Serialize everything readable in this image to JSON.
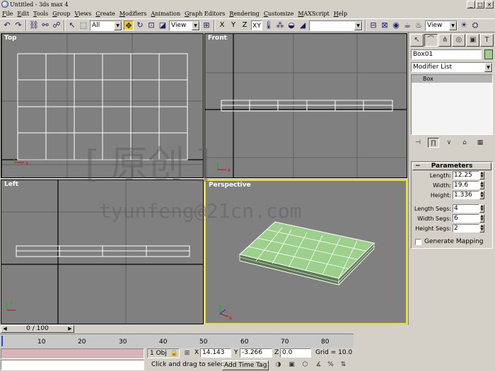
{
  "window": {
    "title": "Untitled - 3ds max 4"
  },
  "menu": [
    "File",
    "Edit",
    "Tools",
    "Group",
    "Views",
    "Create",
    "Modifiers",
    "Animation",
    "Graph Editors",
    "Rendering",
    "Customize",
    "MAXScript",
    "Help"
  ],
  "toolbar": {
    "selection_filter": "All",
    "ref_coord": "View",
    "axis_x": "X",
    "axis_y": "Y",
    "axis_z": "Z",
    "axis_xy": "XY",
    "named_selection": "",
    "render_type": "View"
  },
  "viewports": {
    "top": "Top",
    "front": "Front",
    "left": "Left",
    "perspective": "Perspective"
  },
  "watermark": {
    "line1": "[ 原创 ]",
    "line2": "tyunfeng@21cn.com"
  },
  "command_panel": {
    "object_name": "Box01",
    "object_color": "#9cd08c",
    "modifier_list": "Modifier List",
    "stack_item": "Box",
    "parameters_title": "Parameters",
    "params": [
      {
        "label": "Length:",
        "value": "12.25"
      },
      {
        "label": "Width:",
        "value": "19.6"
      },
      {
        "label": "Height:",
        "value": "1.336"
      },
      {
        "label": "Length Segs:",
        "value": "4"
      },
      {
        "label": "Width Segs:",
        "value": "6"
      },
      {
        "label": "Height Segs:",
        "value": "2"
      }
    ],
    "generate_mapping": "Generate Mapping"
  },
  "timeline": {
    "frame": "0 / 100",
    "ticks": [
      "10",
      "20",
      "30",
      "40",
      "50",
      "60",
      "70",
      "80"
    ]
  },
  "status": {
    "selected": "1 Obj",
    "x_label": "X",
    "x_value": "14.143",
    "y_label": "Y",
    "y_value": "-3.266",
    "z_label": "Z",
    "z_value": "0.0",
    "grid": "Grid = 10.0",
    "prompt": "Click and drag to selec",
    "add_time_tag": "Add Time Tag"
  }
}
